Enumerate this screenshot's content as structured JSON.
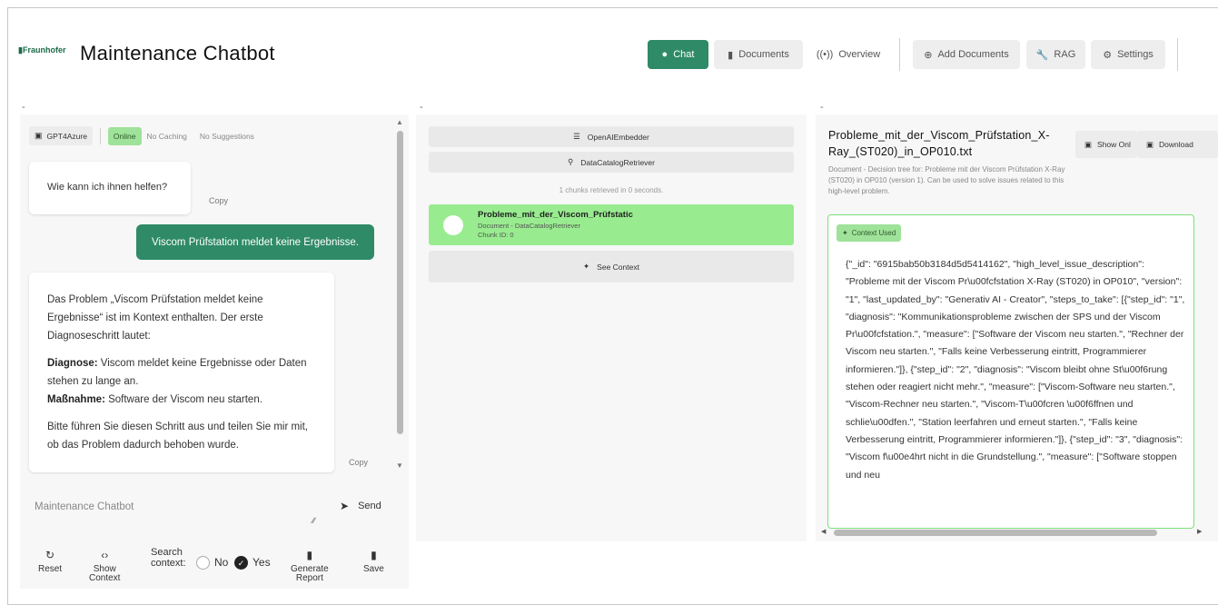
{
  "app": {
    "logo_text": "Fraunhofer",
    "title": "Maintenance Chatbot"
  },
  "nav": {
    "chat": "Chat",
    "documents": "Documents",
    "overview": "Overview",
    "add_documents": "Add Documents",
    "rag": "RAG",
    "settings": "Settings"
  },
  "left": {
    "model": "GPT4Azure",
    "online": "Online",
    "caching": "No Caching",
    "suggestions": "No Suggestions",
    "bot_greeting": "Wie kann ich ihnen helfen?",
    "copy_label": "Copy",
    "user_message": "Viscom Prüfstation meldet keine Ergebnisse.",
    "bot_answer_intro": "Das Problem „Viscom Prüfstation meldet keine Ergebnisse“ ist im Kontext enthalten. Der erste Diagnoseschritt lautet:",
    "diagnose_label": "Diagnose:",
    "diagnose_text": " Viscom meldet keine Ergebnisse oder Daten stehen zu lange an.",
    "measure_label": "Maßnahme:",
    "measure_text": " Software der Viscom neu starten.",
    "bot_answer_outro": "Bitte führen Sie diesen Schritt aus und teilen Sie mir mit, ob das Problem dadurch behoben wurde.",
    "input_placeholder": "Maintenance Chatbot",
    "send_label": "Send",
    "toolbar": {
      "reset": "Reset",
      "show_context_1": "Show",
      "show_context_2": "Context",
      "search_context_1": "Search",
      "search_context_2": "context:",
      "no": "No",
      "yes": "Yes",
      "generate_1": "Generate",
      "generate_2": "Report",
      "save": "Save"
    }
  },
  "middle": {
    "embedder": "OpenAIEmbedder",
    "retriever": "DataCatalogRetriever",
    "retrieved_info": "1 chunks retrieved in 0 seconds.",
    "chunk_title": "Probleme_mit_der_Viscom_Prüfstatic",
    "chunk_source": "Document - DataCatalogRetriever",
    "chunk_id": "Chunk ID: 0",
    "see_context": "See Context"
  },
  "right": {
    "title": "Probleme_mit_der_Viscom_Prüfstation_X-Ray_(ST020)_in_OP010.txt",
    "subtitle": "Document - Decision tree for: Probleme mit der Viscom Prüfstation X-Ray (ST020) in OP010 (version 1). Can be used to solve issues related to this high-level problem.",
    "show_only": "Show Onl",
    "download": "Download",
    "context_used": "Context Used",
    "context_json": "{\"_id\": \"6915bab50b3184d5d5414162\", \"high_level_issue_description\": \"Probleme mit der Viscom Pr\\u00fcfstation X-Ray (ST020) in OP010\", \"version\": \"1\", \"last_updated_by\": \"Generativ AI - Creator\", \"steps_to_take\": [{\"step_id\": \"1\", \"diagnosis\": \"Kommunikationsprobleme zwischen der SPS und der Viscom Pr\\u00fcfstation.\", \"measure\": [\"Software der Viscom neu starten.\", \"Rechner der Viscom neu starten.\", \"Falls keine Verbesserung eintritt, Programmierer informieren.\"]}, {\"step_id\": \"2\", \"diagnosis\": \"Viscom bleibt ohne St\\u00f6rung stehen oder reagiert nicht mehr.\", \"measure\": [\"Viscom-Software neu starten.\", \"Viscom-Rechner neu starten.\", \"Viscom-T\\u00fcren \\u00f6ffnen und schlie\\u00dfen.\", \"Station leerfahren und erneut starten.\", \"Falls keine Verbesserung eintritt, Programmierer informieren.\"]}, {\"step_id\": \"3\", \"diagnosis\": \"Viscom f\\u00e4hrt nicht in die Grundstellung.\", \"measure\": [\"Software stoppen und neu"
  },
  "colors": {
    "accent": "#2f8a68",
    "online_green": "#9fe29a",
    "chunk_green": "#98ec8f"
  }
}
